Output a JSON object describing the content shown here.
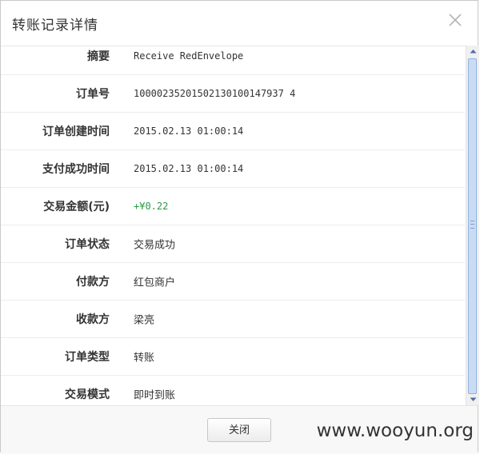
{
  "dialog": {
    "title": "转账记录详情",
    "close_icon": "close-icon"
  },
  "rows": [
    {
      "label": "摘要",
      "value": "Receive RedEnvelope"
    },
    {
      "label": "订单号",
      "value": "10000235201502130100147937 4"
    },
    {
      "label": "订单创建时间",
      "value": "2015.02.13 01:00:14"
    },
    {
      "label": "支付成功时间",
      "value": "2015.02.13 01:00:14"
    },
    {
      "label": "交易金额(元)",
      "value": "+¥0.22"
    },
    {
      "label": "订单状态",
      "value": "交易成功"
    },
    {
      "label": "付款方",
      "value": "红包商户"
    },
    {
      "label": "收款方",
      "value": "梁亮"
    },
    {
      "label": "订单类型",
      "value": "转账"
    },
    {
      "label": "交易模式",
      "value": "即时到账"
    }
  ],
  "footer": {
    "close_button": "关闭"
  },
  "watermark": "www.wooyun.org",
  "colors": {
    "amount_green": "#2a9a46",
    "scroll_thumb": "#c9dcf4"
  }
}
